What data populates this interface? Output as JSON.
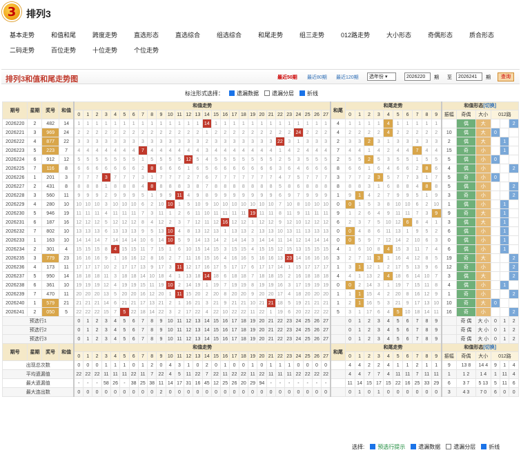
{
  "title": "排列3",
  "nav": [
    "基本走势",
    "和值和尾",
    "跨度走势",
    "直选形态",
    "直选综合",
    "组选综合",
    "和尾走势",
    "组三走势",
    "012路走势",
    "大小形态",
    "奇偶形态",
    "质合形态",
    "二码走势",
    "百位走势",
    "十位走势",
    "个位走势"
  ],
  "chart_title": "排列3和值和尾走势图",
  "filters": {
    "latest50": "最近50期",
    "latest80": "最近80期",
    "latest120": "最近120期",
    "year_select": "选年份",
    "from": "2026220",
    "to_label": "至",
    "to": "2026241",
    "period": "期",
    "query": "查询"
  },
  "mark_label": "标注形式选择：",
  "mark_opts": [
    "遗漏数据",
    "遗漏分层",
    "折线"
  ],
  "headers": {
    "issue": "期号",
    "week": "星期",
    "award": "奖号",
    "sum": "和值",
    "sum_trend": "和值走势",
    "tail": "和尾",
    "tail_trend": "和尾走势",
    "shape": "和值形态",
    "switch": "[切换]",
    "amp": "振幅",
    "oe": "奇偶",
    "bs": "大小",
    "r012": "012路"
  },
  "rows": [
    {
      "issue": "2026220",
      "week": "2",
      "award": "482",
      "sum": 14,
      "tail": 4,
      "amp": "",
      "oe": "偶",
      "bs": "大",
      "r": "2"
    },
    {
      "issue": "2026221",
      "week": "3",
      "award": "969",
      "sum": 24,
      "tail": 4,
      "amp": "10",
      "oe": "偶",
      "bs": "大",
      "r": "0"
    },
    {
      "issue": "2026222",
      "week": "4",
      "award": "877",
      "sum": 22,
      "tail": 2,
      "amp": "2",
      "oe": "偶",
      "bs": "大",
      "r": "1"
    },
    {
      "issue": "2026223",
      "week": "5",
      "award": "223",
      "sum": 7,
      "tail": 7,
      "amp": "15",
      "oe": "奇",
      "bs": "小",
      "r": "1"
    },
    {
      "issue": "2026224",
      "week": "6",
      "award": "912",
      "sum": 12,
      "tail": 2,
      "amp": "5",
      "oe": "偶",
      "bs": "小",
      "r": "0"
    },
    {
      "issue": "2026225",
      "week": "7",
      "award": "116",
      "sum": 8,
      "tail": 8,
      "amp": "4",
      "oe": "偶",
      "bs": "小",
      "r": "2"
    },
    {
      "issue": "2026226",
      "week": "1",
      "award": "201",
      "sum": 3,
      "tail": 3,
      "amp": "5",
      "oe": "奇",
      "bs": "小",
      "r": "0"
    },
    {
      "issue": "2026227",
      "week": "2",
      "award": "431",
      "sum": 8,
      "tail": 8,
      "amp": "5",
      "oe": "偶",
      "bs": "小",
      "r": "2"
    },
    {
      "issue": "2026228",
      "week": "3",
      "award": "560",
      "sum": 11,
      "tail": 1,
      "amp": "3",
      "oe": "奇",
      "bs": "小",
      "r": "2"
    },
    {
      "issue": "2026229",
      "week": "4",
      "award": "280",
      "sum": 10,
      "tail": 0,
      "amp": "1",
      "oe": "偶",
      "bs": "小",
      "r": "1"
    },
    {
      "issue": "2026230",
      "week": "5",
      "award": "946",
      "sum": 19,
      "tail": 9,
      "amp": "9",
      "oe": "奇",
      "bs": "大",
      "r": "1"
    },
    {
      "issue": "2026231",
      "week": "6",
      "award": "187",
      "sum": 16,
      "tail": 6,
      "amp": "3",
      "oe": "偶",
      "bs": "大",
      "r": "1"
    },
    {
      "issue": "2026232",
      "week": "7",
      "award": "802",
      "sum": 10,
      "tail": 0,
      "amp": "6",
      "oe": "偶",
      "bs": "小",
      "r": "1"
    },
    {
      "issue": "2026233",
      "week": "1",
      "award": "163",
      "sum": 10,
      "tail": 0,
      "amp": "0",
      "oe": "偶",
      "bs": "小",
      "r": "1"
    },
    {
      "issue": "2026234",
      "week": "2",
      "award": "301",
      "sum": 4,
      "tail": 4,
      "amp": "6",
      "oe": "偶",
      "bs": "小",
      "r": "1"
    },
    {
      "issue": "2026235",
      "week": "3",
      "award": "779",
      "sum": 23,
      "tail": 3,
      "amp": "19",
      "oe": "奇",
      "bs": "大",
      "r": "2"
    },
    {
      "issue": "2026236",
      "week": "4",
      "award": "173",
      "sum": 11,
      "tail": 1,
      "amp": "12",
      "oe": "奇",
      "bs": "小",
      "r": "2"
    },
    {
      "issue": "2026237",
      "week": "5",
      "award": "950",
      "sum": 14,
      "tail": 4,
      "amp": "3",
      "oe": "偶",
      "bs": "大",
      "r": "2"
    },
    {
      "issue": "2026238",
      "week": "6",
      "award": "361",
      "sum": 10,
      "tail": 0,
      "amp": "4",
      "oe": "偶",
      "bs": "小",
      "r": "1"
    },
    {
      "issue": "2026239",
      "week": "7",
      "award": "470",
      "sum": 11,
      "tail": 1,
      "amp": "1",
      "oe": "奇",
      "bs": "小",
      "r": "2"
    },
    {
      "issue": "2026240",
      "week": "1",
      "award": "579",
      "sum": 21,
      "tail": 1,
      "amp": "10",
      "oe": "奇",
      "bs": "大",
      "r": "0"
    },
    {
      "issue": "2026241",
      "week": "2",
      "award": "050",
      "sum": 5,
      "tail": 5,
      "amp": "16",
      "oe": "奇",
      "bs": "小",
      "r": "2"
    }
  ],
  "preview": [
    "预选行1",
    "预选行2",
    "预选行3"
  ],
  "stats": [
    {
      "label": "出现总次数",
      "sum": "0 0 0 1 1 1 0 1 2 0 4 3 1 0 2 0 1 0 0 1 0 1 1 1 0 0 0 0",
      "tail": "4 4 2 2 4 1 1 2 1 1",
      "amp": "9 13 8 14 4 9 1 4 1 1"
    },
    {
      "label": "平均遗漏值",
      "sum": "22 22 22 11 11 11 22 11 7 22 4 5 11 22 7 22 11 22 22 11 22 11 11 11 22 22 22 22",
      "tail": "4 4 7 7 4 11 11 7 11 11",
      "amp": "1 1 2 1 4 1 11 4 11 11"
    },
    {
      "label": "最大遗漏值",
      "sum": "- - - 58 26 - 38 25 38 11 14 17 31 16 45 12 25 26 20 29 94 - - - - - - -",
      "tail": "11 14 15 17 15 22 16 25 33 29",
      "amp": "6 3 7 5 13 5 11 6 12 11"
    },
    {
      "label": "最大连出数",
      "sum": "0 0 0 0 0 0 0 0 0 2 0 0 0 0 0 0 0 0 0 0 0 0 0 0 0 0 0 0",
      "tail": "0 1 0 1 0 0 0 0 0 0",
      "amp": "3 4 3 7 0 6 0 0 1 0"
    }
  ],
  "footer": {
    "label": "选择:",
    "opts": [
      "预选行提示",
      "遗漏数据",
      "遗漏分层",
      "折线"
    ]
  }
}
